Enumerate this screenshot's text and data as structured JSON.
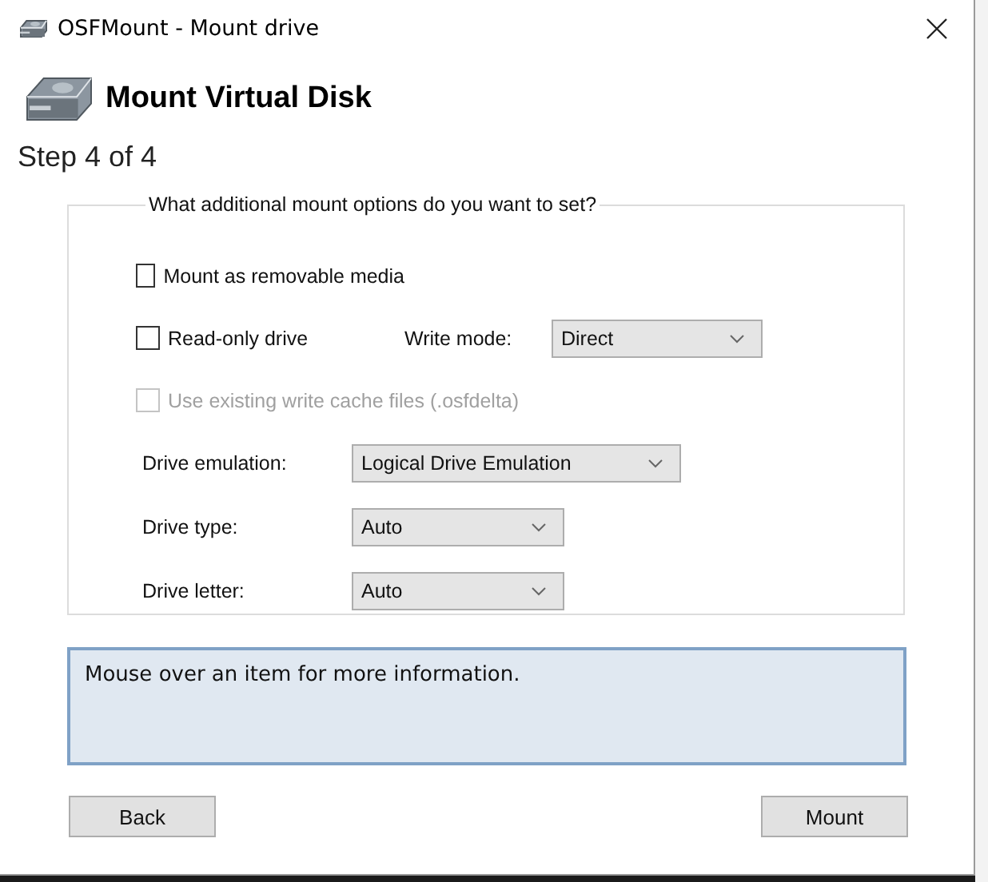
{
  "window": {
    "title": "OSFMount - Mount drive"
  },
  "header": {
    "title": "Mount Virtual Disk",
    "step": "Step 4 of 4"
  },
  "options": {
    "legend": "What additional mount options do you want to set?",
    "checkboxes": [
      {
        "label": "Mount as removable media",
        "checked": false,
        "disabled": false
      },
      {
        "label": "Read-only drive",
        "checked": false,
        "disabled": false,
        "side": {
          "label": "Write mode:",
          "value": "Direct"
        }
      },
      {
        "label": "Use existing write cache files (.osfdelta)",
        "checked": false,
        "disabled": true
      }
    ],
    "dropdowns": [
      {
        "label": "Drive emulation:",
        "value": "Logical Drive Emulation"
      },
      {
        "label": "Drive type:",
        "value": "Auto"
      },
      {
        "label": "Drive letter:",
        "value": "Auto"
      }
    ]
  },
  "info": {
    "text": "Mouse over an item for more information."
  },
  "buttons": [
    {
      "label": "Back"
    },
    {
      "label": "Mount"
    }
  ]
}
